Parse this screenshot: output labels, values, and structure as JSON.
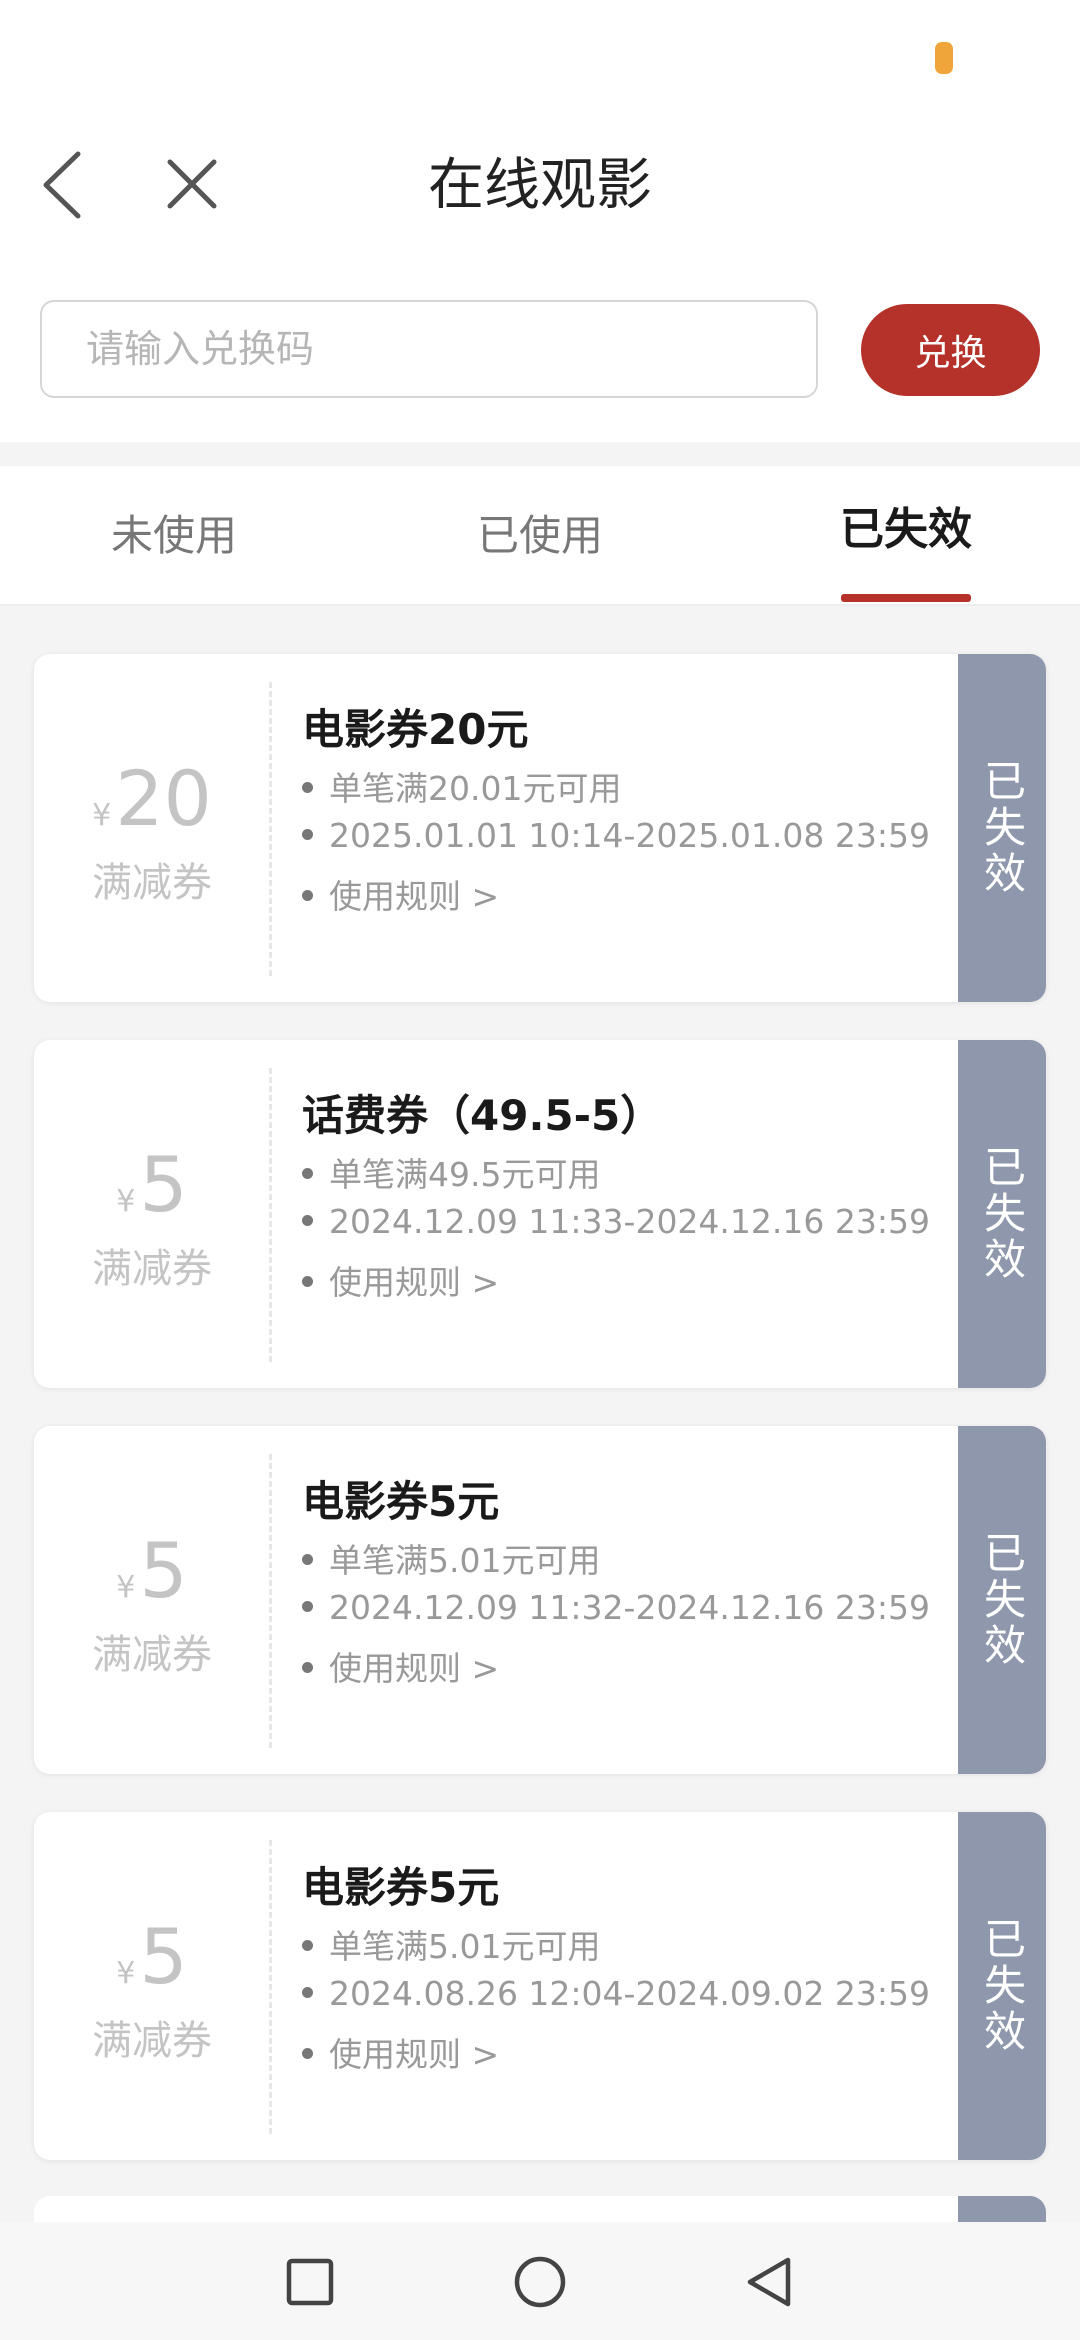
{
  "header": {
    "title": "在线观影"
  },
  "redeem": {
    "placeholder": "请输入兑换码",
    "button_label": "兑换"
  },
  "tabs": [
    {
      "label": "未使用"
    },
    {
      "label": "已使用"
    },
    {
      "label": "已失效",
      "active": true
    }
  ],
  "coupons": [
    {
      "currency": "¥",
      "amount": "20",
      "type": "满减券",
      "title": "电影券20元",
      "condition": "单笔满20.01元可用",
      "validity": "2025.01.01 10:14-2025.01.08 23:59",
      "rules": "使用规则 >",
      "status": "已失效"
    },
    {
      "currency": "¥",
      "amount": "5",
      "type": "满减券",
      "title": "话费券（49.5-5）",
      "condition": "单笔满49.5元可用",
      "validity": "2024.12.09 11:33-2024.12.16 23:59",
      "rules": "使用规则 >",
      "status": "已失效"
    },
    {
      "currency": "¥",
      "amount": "5",
      "type": "满减券",
      "title": "电影券5元",
      "condition": "单笔满5.01元可用",
      "validity": "2024.12.09 11:32-2024.12.16 23:59",
      "rules": "使用规则 >",
      "status": "已失效"
    },
    {
      "currency": "¥",
      "amount": "5",
      "type": "满减券",
      "title": "电影券5元",
      "condition": "单笔满5.01元可用",
      "validity": "2024.08.26 12:04-2024.09.02 23:59",
      "rules": "使用规则 >",
      "status": "已失效"
    }
  ],
  "colors": {
    "accent": "#b5322b",
    "expired_stamp": "#8e97ac",
    "background": "#f4f4f4"
  },
  "icons": {
    "back": "chevron-left-icon",
    "close": "close-icon",
    "nav_recents": "square-icon",
    "nav_home": "circle-icon",
    "nav_back": "triangle-back-icon"
  }
}
